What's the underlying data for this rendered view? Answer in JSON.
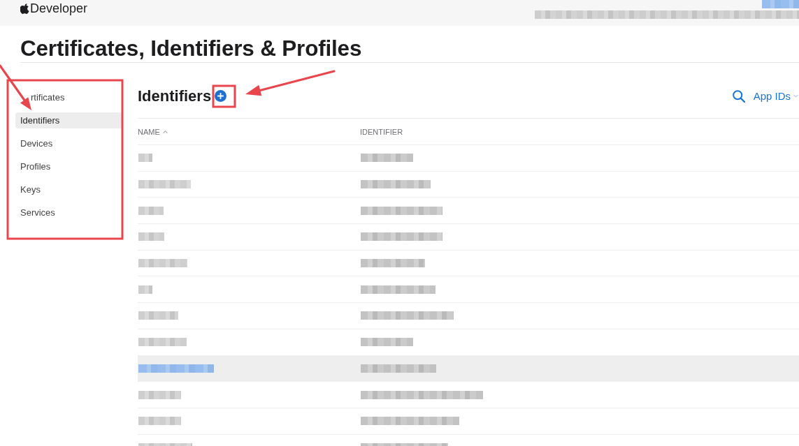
{
  "header": {
    "brand": "Developer"
  },
  "page_title": "Certificates, Identifiers & Profiles",
  "sidebar": {
    "items": [
      {
        "label": "rtificates",
        "selected": false,
        "partly_hidden": true
      },
      {
        "label": "Identifiers",
        "selected": true,
        "partly_hidden": false
      },
      {
        "label": "Devices",
        "selected": false,
        "partly_hidden": false
      },
      {
        "label": "Profiles",
        "selected": false,
        "partly_hidden": false
      },
      {
        "label": "Keys",
        "selected": false,
        "partly_hidden": false
      },
      {
        "label": "Services",
        "selected": false,
        "partly_hidden": false
      }
    ]
  },
  "section": {
    "title": "Identifiers",
    "filter": "App IDs"
  },
  "table": {
    "columns": [
      {
        "label": "NAME",
        "sorted": true
      },
      {
        "label": "IDENTIFIER",
        "sorted": false
      }
    ],
    "rows": [
      {
        "selected": false
      },
      {
        "selected": false
      },
      {
        "selected": false
      },
      {
        "selected": false
      },
      {
        "selected": false
      },
      {
        "selected": false
      },
      {
        "selected": false
      },
      {
        "selected": false
      },
      {
        "selected": true
      },
      {
        "selected": false
      },
      {
        "selected": false
      },
      {
        "selected": false
      }
    ]
  }
}
